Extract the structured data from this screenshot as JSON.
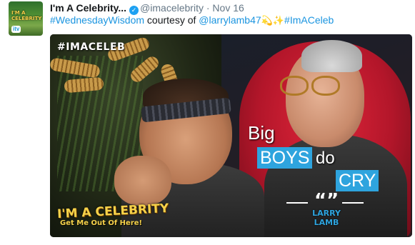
{
  "tweet": {
    "author_name": "I'm A Celebrity...",
    "handle": "@imacelebrity",
    "separator": "·",
    "date": "Nov 16",
    "text_parts": [
      {
        "text": "#WednesdayWisdom",
        "type": "link"
      },
      {
        "text": " courtesy of ",
        "type": "text"
      },
      {
        "text": "@larrylamb47",
        "type": "link"
      },
      {
        "text": " 💫✨ ",
        "type": "emoji"
      },
      {
        "text": "#ImACeleb",
        "type": "link"
      }
    ]
  },
  "avatar": {
    "logo_text": "I'M A CELEBRITY",
    "channel": "itv"
  },
  "media": {
    "hashtag": "#IMACELEB",
    "brand_line1": "I'M A CELEBRITY",
    "brand_line2": "Get Me Out Of Here!",
    "caption": {
      "word1": "Big",
      "word2": "BOYS",
      "word3": "do",
      "word4": "CRY"
    },
    "quote_mark": "“”",
    "quote_name_line1": "LARRY",
    "quote_name_line2": "LAMB"
  },
  "colors": {
    "link": "#1b95e0",
    "verified": "#1da1f2",
    "caption_box": "#2ea4de",
    "brand_yellow": "#f6d24a"
  }
}
